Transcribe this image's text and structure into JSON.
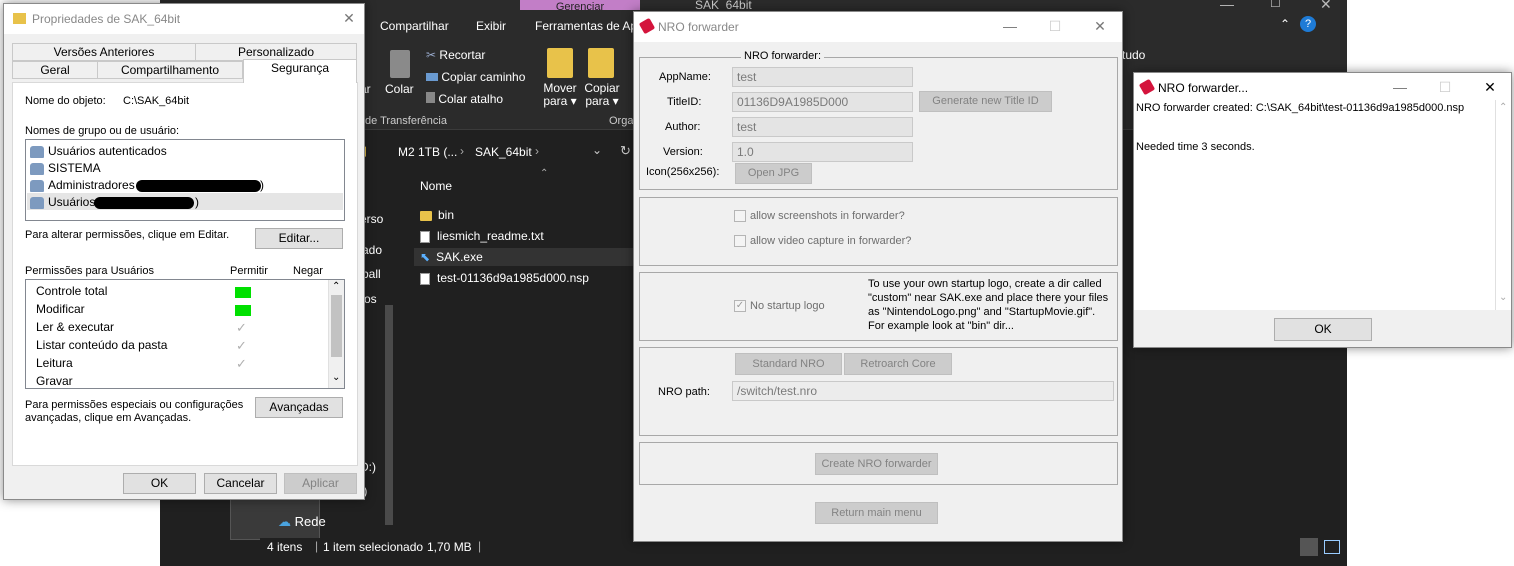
{
  "explorer": {
    "tabs": [
      "Compartilhar",
      "Exibir",
      "Ferramentas de Ap"
    ],
    "contextual_tab": "Gerenciar",
    "title_fragment": "SAK_64bit",
    "ribbon": {
      "colar": "Colar",
      "recortar": "Recortar",
      "copiar_caminho": "Copiar caminho",
      "colar_atalho": "Colar atalho",
      "area_transferencia": "de Transferência",
      "mover_para": "Mover para ▾",
      "copiar_para": "Copiar para ▾",
      "org": "Orga",
      "ar": "ar",
      "tudo": "tudo"
    },
    "breadcrumb": [
      "M2 1TB (...",
      "SAK_64bit"
    ],
    "column_header": "Nome",
    "files": [
      {
        "name": "bin",
        "type": "folder"
      },
      {
        "name": "liesmich_readme.txt",
        "type": "text"
      },
      {
        "name": "SAK.exe",
        "type": "exe"
      },
      {
        "name": "test-01136d9a1985d000.nsp",
        "type": "doc"
      }
    ],
    "nav_fragments": [
      "erso",
      "ado",
      "ball",
      "os",
      ")",
      "D:)",
      ":)"
    ],
    "network": "Rede",
    "status": {
      "items": "4 itens",
      "selected": "1 item selecionado",
      "size": "1,70 MB"
    }
  },
  "props": {
    "title": "Propriedades de SAK_64bit",
    "tabs_top": [
      "Versões Anteriores",
      "Personalizado"
    ],
    "tabs_bottom": [
      "Geral",
      "Compartilhamento",
      "Segurança"
    ],
    "object_label": "Nome do objeto:",
    "object_value": "C:\\SAK_64bit",
    "groups_label": "Nomes de grupo ou de usuário:",
    "users": [
      "Usuários autenticados",
      "SISTEMA",
      "Administradores",
      "Usuários"
    ],
    "users_suffix": [
      ")",
      ")"
    ],
    "edit_hint": "Para alterar permissões, clique em Editar.",
    "edit_button": "Editar...",
    "perm_label": "Permissões para Usuários",
    "perm_allow": "Permitir",
    "perm_deny": "Negar",
    "permissions": [
      "Controle total",
      "Modificar",
      "Ler & executar",
      "Listar conteúdo da pasta",
      "Leitura",
      "Gravar"
    ],
    "special_hint_1": "Para permissões especiais ou configurações",
    "special_hint_2": "avançadas, clique em Avançadas.",
    "advanced_button": "Avançadas",
    "ok": "OK",
    "cancel": "Cancelar",
    "apply": "Aplicar"
  },
  "nro": {
    "title": "NRO forwarder",
    "group_title": "NRO forwarder:",
    "appname_label": "AppName:",
    "appname_value": "test",
    "titleid_label": "TitleID:",
    "titleid_value": "01136D9A1985D000",
    "generate_button": "Generate new Title ID",
    "author_label": "Author:",
    "author_value": "test",
    "version_label": "Version:",
    "version_value": "1.0",
    "icon_label": "Icon(256x256):",
    "open_jpg": "Open JPG",
    "allow_screenshots": "allow screenshots in forwarder?",
    "allow_video": "allow video capture in forwarder?",
    "no_startup_logo": "No startup logo",
    "logo_info": [
      "To use your own startup logo, create a dir called",
      "\"custom\" near SAK.exe and place there your files",
      "as \"NintendoLogo.png\" and \"StartupMovie.gif\".",
      "For example look at \"bin\" dir..."
    ],
    "standard_nro": "Standard NRO",
    "retroarch_core": "Retroarch Core",
    "nro_path_label": "NRO path:",
    "nro_path_value": "/switch/test.nro",
    "create_button": "Create NRO forwarder",
    "return_button": "Return main menu"
  },
  "nro2": {
    "title": "NRO forwarder...",
    "line1": "NRO forwarder created: C:\\SAK_64bit\\test-01136d9a1985d000.nsp",
    "line2": "Needed time 3 seconds.",
    "ok": "OK"
  }
}
